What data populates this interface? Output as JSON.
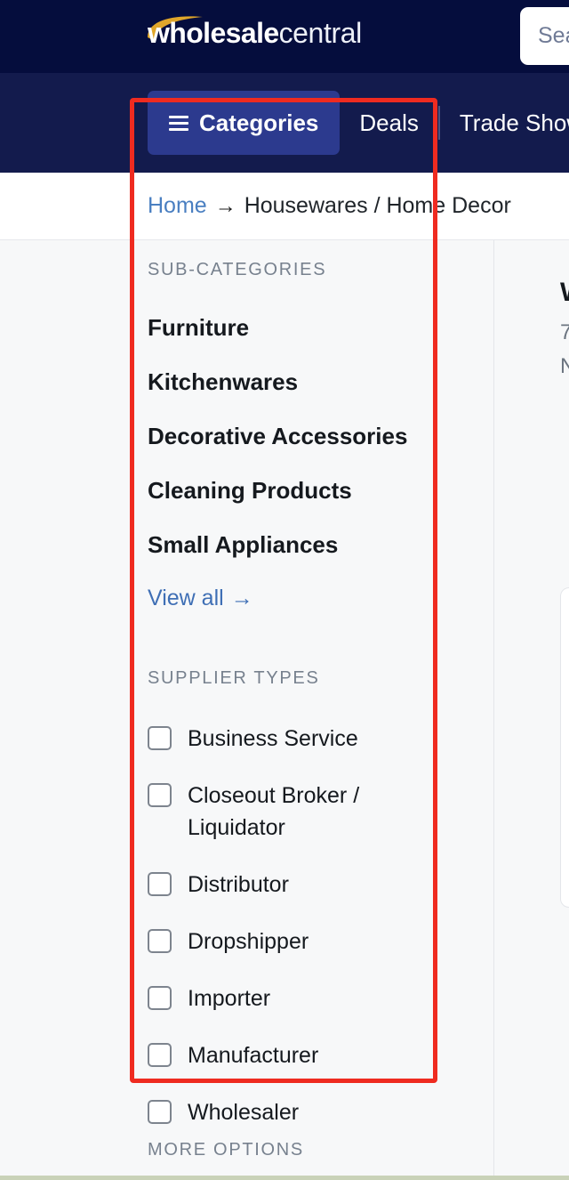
{
  "header": {
    "logo": {
      "bold": "wholesale",
      "light": "central",
      "swoosh_color": "#e0a62a"
    },
    "search": {
      "placeholder": "Search",
      "visible_text": "Sea"
    }
  },
  "nav": {
    "categories_label": "Categories",
    "categories_icon": "list-icon",
    "items": [
      {
        "label": "Deals"
      },
      {
        "label": "Trade Shows"
      }
    ]
  },
  "breadcrumb": {
    "home": "Home",
    "arrow": "→",
    "current": "Housewares / Home Decor"
  },
  "sidebar": {
    "subcategories_heading": "SUB-CATEGORIES",
    "subcategories": [
      {
        "label": "Furniture"
      },
      {
        "label": "Kitchenwares"
      },
      {
        "label": "Decorative Accessories"
      },
      {
        "label": "Cleaning Products"
      },
      {
        "label": "Small Appliances"
      }
    ],
    "view_all": "View all",
    "view_all_arrow": "→",
    "supplier_types_heading": "SUPPLIER TYPES",
    "supplier_types": [
      {
        "label": "Business Service",
        "checked": false
      },
      {
        "label": "Closeout Broker / Liquidator",
        "checked": false
      },
      {
        "label": "Distributor",
        "checked": false
      },
      {
        "label": "Dropshipper",
        "checked": false
      },
      {
        "label": "Importer",
        "checked": false
      },
      {
        "label": "Manufacturer",
        "checked": false
      },
      {
        "label": "Wholesaler",
        "checked": false
      }
    ],
    "more_options_heading": "MORE OPTIONS"
  },
  "right_panel": {
    "title_visible": "W",
    "line1_visible": "7",
    "line2_visible": "N"
  },
  "colors": {
    "header_bg": "#050d3d",
    "nav_bg": "#131b4d",
    "nav_active": "#2c3a8e",
    "content_bg": "#f7f8f9",
    "link_blue": "#3f6fb5",
    "annotation_red": "#ef2b20",
    "logo_gold": "#e0a62a"
  }
}
